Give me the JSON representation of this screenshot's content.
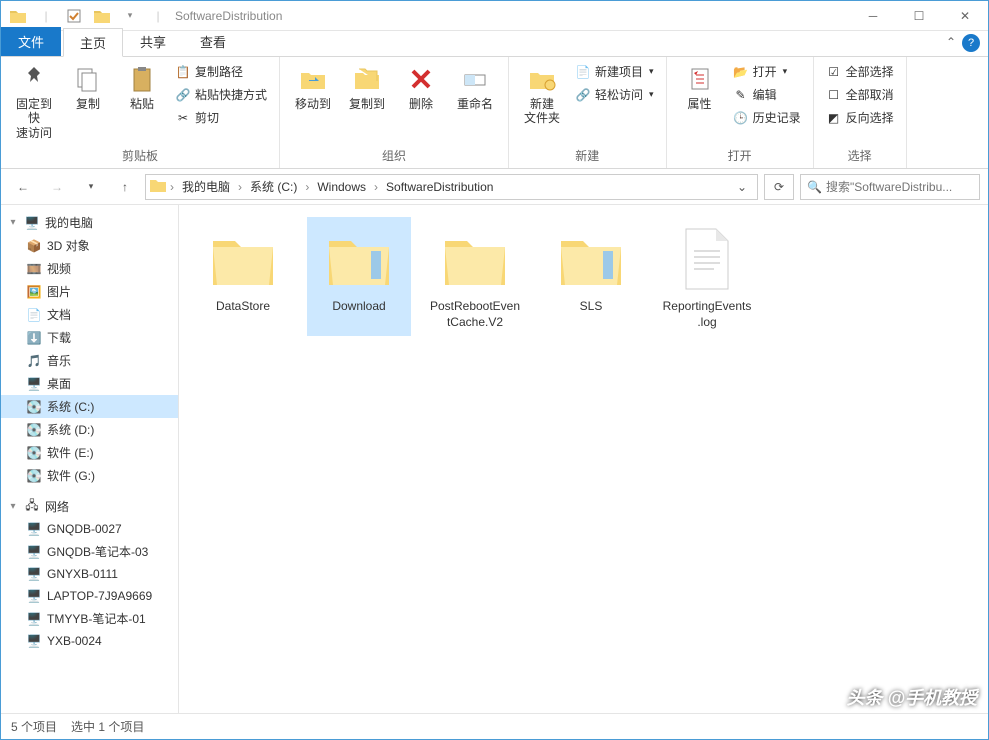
{
  "window": {
    "title": "SoftwareDistribution"
  },
  "tabs": {
    "file": "文件",
    "home": "主页",
    "share": "共享",
    "view": "查看"
  },
  "ribbon": {
    "pin": "固定到快\n速访问",
    "copy": "复制",
    "paste": "粘贴",
    "copypath": "复制路径",
    "pasteshortcut": "粘贴快捷方式",
    "cut": "剪切",
    "group_clipboard": "剪贴板",
    "moveto": "移动到",
    "copyto": "复制到",
    "delete": "删除",
    "rename": "重命名",
    "group_organize": "组织",
    "newfolder": "新建\n文件夹",
    "newitem": "新建项目",
    "easyaccess": "轻松访问",
    "group_new": "新建",
    "properties": "属性",
    "open": "打开",
    "edit": "编辑",
    "history": "历史记录",
    "group_open": "打开",
    "selectall": "全部选择",
    "selectnone": "全部取消",
    "invertsel": "反向选择",
    "group_select": "选择"
  },
  "breadcrumb": {
    "items": [
      "我的电脑",
      "系统 (C:)",
      "Windows",
      "SoftwareDistribution"
    ]
  },
  "search": {
    "placeholder": "搜索\"SoftwareDistribu..."
  },
  "sidebar": {
    "mycomputer": "我的电脑",
    "objects3d": "3D 对象",
    "videos": "视频",
    "pictures": "图片",
    "documents": "文档",
    "downloads": "下载",
    "music": "音乐",
    "desktop": "桌面",
    "systemc": "系统 (C:)",
    "systemd": "系统 (D:)",
    "softwaree": "软件 (E:)",
    "softwareg": "软件 (G:)",
    "network": "网络",
    "net1": "GNQDB-0027",
    "net2": "GNQDB-笔记本-03",
    "net3": "GNYXB-0111",
    "net4": "LAPTOP-7J9A9669",
    "net5": "TMYYB-笔记本-01",
    "net6": "YXB-0024"
  },
  "files": {
    "f1": "DataStore",
    "f2": "Download",
    "f3": "PostRebootEventCache.V2",
    "f4": "SLS",
    "f5": "ReportingEvents.log"
  },
  "status": {
    "count": "5 个项目",
    "selected": "选中 1 个项目"
  },
  "watermark": "头条 @手机教授"
}
